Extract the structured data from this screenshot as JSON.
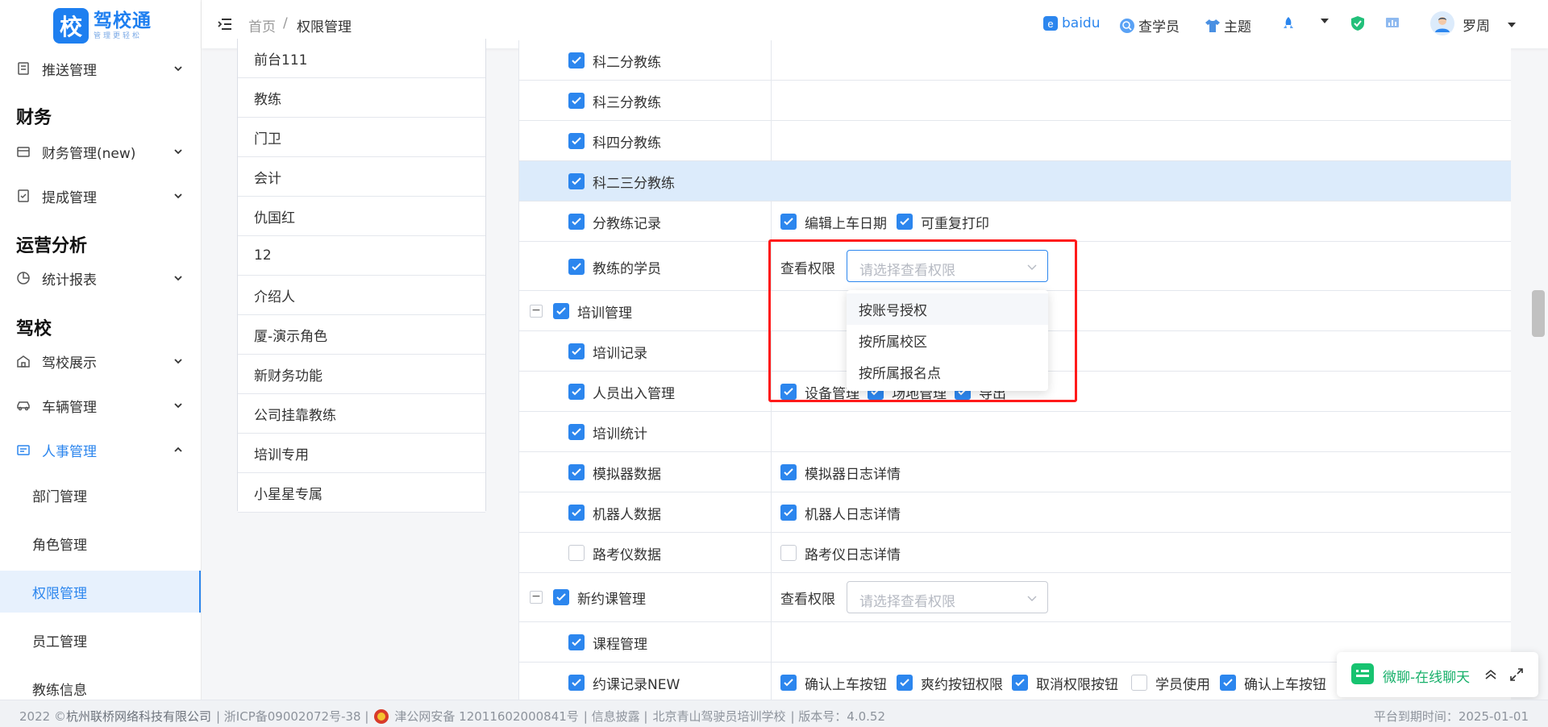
{
  "app": {
    "logo_char": "校",
    "logo_name": "驾校通",
    "logo_slogan": "管理更轻松"
  },
  "sidebar": {
    "items": [
      {
        "label": "推送管理"
      },
      {
        "group": "财务"
      },
      {
        "label": "财务管理(new)"
      },
      {
        "label": "提成管理"
      },
      {
        "group": "运营分析"
      },
      {
        "label": "统计报表"
      },
      {
        "group": "驾校"
      },
      {
        "label": "驾校展示"
      },
      {
        "label": "车辆管理"
      },
      {
        "label": "人事管理"
      }
    ],
    "sub_items": [
      "部门管理",
      "角色管理",
      "权限管理",
      "员工管理",
      "教练信息"
    ]
  },
  "header": {
    "breadcrumb": {
      "home": "首页",
      "sep": "/",
      "current": "权限管理"
    },
    "baidu": "baidu",
    "student_lookup": "查学员",
    "theme": "主题",
    "user": "罗周"
  },
  "roles": [
    "前台111",
    "教练",
    "门卫",
    "会计",
    "仇国红",
    "12",
    "介绍人",
    "厦-演示角色",
    "新财务功能",
    "公司挂靠教练",
    "培训专用",
    "小星星专属"
  ],
  "permissions": {
    "rows": [
      {
        "label": "科二分教练",
        "checked": true
      },
      {
        "label": "科三分教练",
        "checked": true
      },
      {
        "label": "科四分教练",
        "checked": true
      },
      {
        "label": "科二三分教练",
        "checked": true
      },
      {
        "label": "分教练记录",
        "checked": true,
        "subs": [
          {
            "label": "编辑上车日期",
            "checked": true
          },
          {
            "label": "可重复打印",
            "checked": true
          }
        ]
      },
      {
        "label": "教练的学员",
        "checked": true,
        "view_label": "查看权限",
        "view_placeholder": "请选择查看权限"
      },
      {
        "label": "培训管理",
        "checked": true
      },
      {
        "label": "培训记录",
        "checked": true
      },
      {
        "label": "人员出入管理",
        "checked": true,
        "subs": [
          {
            "label": "设备管理",
            "checked": true
          },
          {
            "label": "场地管理",
            "checked": true
          },
          {
            "label": "导出",
            "checked": true
          }
        ]
      },
      {
        "label": "培训统计",
        "checked": true
      },
      {
        "label": "模拟器数据",
        "checked": true,
        "subs": [
          {
            "label": "模拟器日志详情",
            "checked": true
          }
        ]
      },
      {
        "label": "机器人数据",
        "checked": true,
        "subs": [
          {
            "label": "机器人日志详情",
            "checked": true
          }
        ]
      },
      {
        "label": "路考仪数据",
        "checked": false,
        "subs": [
          {
            "label": "路考仪日志详情",
            "checked": false
          }
        ]
      },
      {
        "label": "新约课管理",
        "checked": true,
        "view_label": "查看权限",
        "view_placeholder": "请选择查看权限"
      },
      {
        "label": "课程管理",
        "checked": true
      },
      {
        "label": "约课记录NEW",
        "checked": true,
        "subs": [
          {
            "label": "确认上车按钮",
            "checked": true
          },
          {
            "label": "爽约按钮权限",
            "checked": true
          },
          {
            "label": "取消权限按钮",
            "checked": true
          },
          {
            "label": "学员使用",
            "checked": false
          },
          {
            "label": "确认上车按钮",
            "checked": true
          }
        ]
      }
    ]
  },
  "dropdown": {
    "options": [
      "按账号授权",
      "按所属校区",
      "按所属报名点"
    ]
  },
  "chat": {
    "label": "微聊-在线聊天"
  },
  "footer": {
    "left_prefix": "2022 ©",
    "company": "杭州联桥网络科技有限公司",
    "icp": "| 浙ICP备09002072号-38 |",
    "police": "津公网安备 12011602000841号",
    "disclosure": "| 信息披露 |",
    "school": "北京青山驾驶员培训学校",
    "version": "| 版本号：4.0.52",
    "expiry": "平台到期时间：2025-01-01"
  },
  "colors": {
    "accent": "#2c86ee",
    "highlight_row": "#dcebfb",
    "annotation_box": "#ff1a1a",
    "chat_green": "#17c370"
  }
}
